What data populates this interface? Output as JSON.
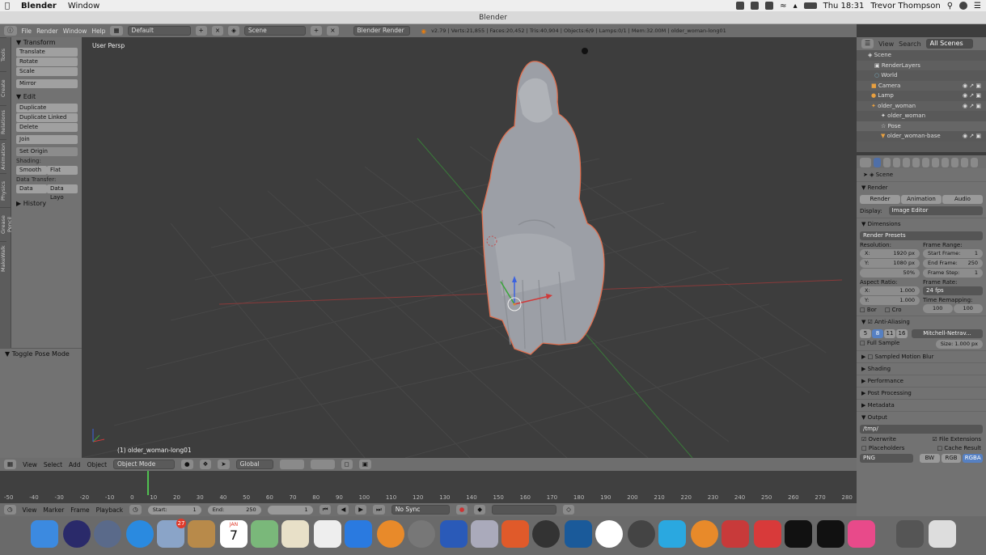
{
  "menubar": {
    "app": "Blender",
    "window": "Window",
    "clock": "Thu 18:31",
    "user": "Trevor Thompson"
  },
  "title": "Blender",
  "info": {
    "menus": [
      "File",
      "Render",
      "Window",
      "Help"
    ],
    "screen": "Default",
    "scene": "Scene",
    "engine": "Blender Render",
    "stats": "v2.79 | Verts:21,855 | Faces:20,452 | Tris:40,904 | Objects:6/9 | Lamps:0/1 | Mem:32.00M | older_woman-long01"
  },
  "tooltabs": [
    "Tools",
    "Create",
    "Relations",
    "Animation",
    "Physics",
    "Grease Pencil",
    "MakeWalk"
  ],
  "toolshelf": {
    "transform": "Transform",
    "translate": "Translate",
    "rotate": "Rotate",
    "scale": "Scale",
    "mirror": "Mirror",
    "edit": "Edit",
    "duplicate": "Duplicate",
    "duplicate_linked": "Duplicate Linked",
    "delete": "Delete",
    "join": "Join",
    "set_origin": "Set Origin",
    "shading": "Shading:",
    "smooth": "Smooth",
    "flat": "Flat",
    "data_transfer": "Data Transfer:",
    "data": "Data",
    "data_layo": "Data Layo",
    "history": "History",
    "toggle_pose": "Toggle Pose Mode"
  },
  "viewport": {
    "label": "User Persp",
    "object_label": "(1) older_woman-long01"
  },
  "outliner": {
    "view": "View",
    "search": "Search",
    "filter": "All Scenes",
    "items": [
      "Scene",
      "RenderLayers",
      "World",
      "Camera",
      "Lamp",
      "older_woman",
      "older_woman",
      "Pose",
      "older_woman-base"
    ]
  },
  "props": {
    "context": "Scene",
    "render": "Render",
    "render_btn": "Render",
    "animation_btn": "Animation",
    "audio_btn": "Audio",
    "display_label": "Display:",
    "display_value": "Image Editor",
    "dimensions": "Dimensions",
    "presets": "Render Presets",
    "resolution": "Resolution:",
    "frame_range": "Frame Range:",
    "res_x": "X:",
    "res_x_val": "1920 px",
    "res_y": "Y:",
    "res_y_val": "1080 px",
    "res_pct": "50%",
    "start": "Start Frame:",
    "start_val": "1",
    "end": "End Frame:",
    "end_val": "250",
    "step": "Frame Step:",
    "step_val": "1",
    "aspect": "Aspect Ratio:",
    "framerate": "Frame Rate:",
    "asp_x": "X:",
    "asp_x_val": "1.000",
    "asp_y": "Y:",
    "asp_y_val": "1.000",
    "fps": "24 fps",
    "time_remap": "Time Remapping:",
    "remap_a": "100",
    "remap_b": "100",
    "bor": "Bor",
    "cro": "Cro",
    "aa": "Anti-Aliasing",
    "aa_5": "5",
    "aa_8": "8",
    "aa_11": "11",
    "aa_16": "16",
    "aa_filter": "Mitchell-Netrav...",
    "full_sample": "Full Sample",
    "size": "Size: 1.000 px",
    "motion_blur": "Sampled Motion Blur",
    "shading": "Shading",
    "performance": "Performance",
    "post": "Post Processing",
    "metadata": "Metadata",
    "output": "Output",
    "out_path": "/tmp/",
    "overwrite": "Overwrite",
    "file_ext": "File Extensions",
    "placeholders": "Placeholders",
    "cache": "Cache Result",
    "format": "PNG",
    "bw": "BW",
    "rgb": "RGB",
    "rgba": "RGBA"
  },
  "v3dheader": {
    "view": "View",
    "select": "Select",
    "add": "Add",
    "object": "Object",
    "mode": "Object Mode",
    "orient": "Global"
  },
  "timeline": {
    "ticks": [
      "-50",
      "-40",
      "-30",
      "-20",
      "-10",
      "0",
      "10",
      "20",
      "30",
      "40",
      "50",
      "60",
      "70",
      "80",
      "90",
      "100",
      "110",
      "120",
      "130",
      "140",
      "150",
      "160",
      "170",
      "180",
      "190",
      "200",
      "210",
      "220",
      "230",
      "240",
      "250",
      "260",
      "270",
      "280"
    ],
    "view": "View",
    "marker": "Marker",
    "frame": "Frame",
    "playback": "Playback",
    "start": "Start:",
    "start_val": "1",
    "end": "End:",
    "end_val": "250",
    "current": "1",
    "sync": "No Sync"
  },
  "dock": {
    "calendar_month": "JAN",
    "calendar_day": "7",
    "badge": "27"
  }
}
